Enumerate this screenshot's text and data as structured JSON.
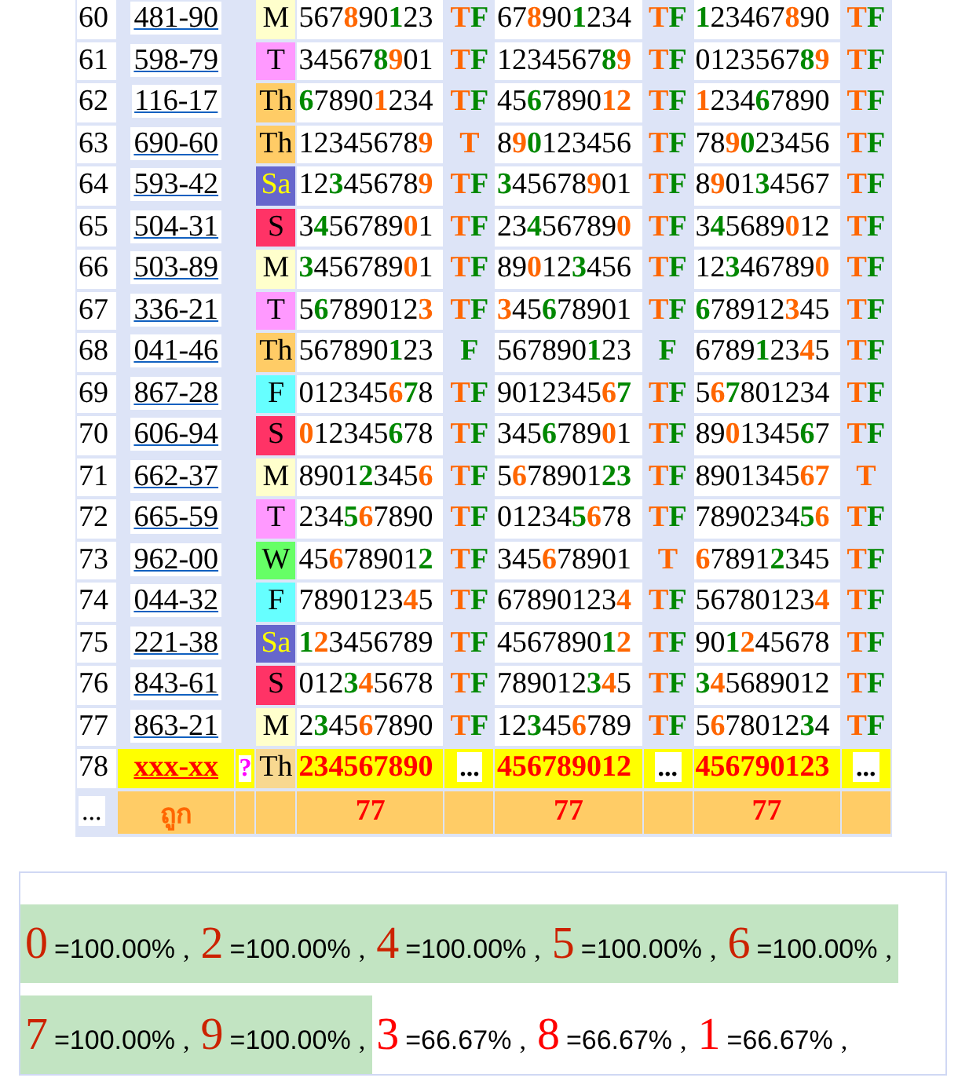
{
  "rows": [
    {
      "kind": "result",
      "no": "60",
      "code": "481-90",
      "day": {
        "text": "M",
        "color": "#ffffcc"
      },
      "draws": [
        {
          "parts": [
            {
              "text": "567"
            },
            {
              "text": "8",
              "color": "#ff6600"
            },
            {
              "text": "90"
            },
            {
              "text": "1",
              "color": "#008800"
            },
            {
              "text": "23"
            }
          ],
          "verdict": [
            {
              "text": "T",
              "color": "#ff6600"
            },
            {
              "text": "F",
              "color": "#008800"
            }
          ]
        },
        {
          "parts": [
            {
              "text": "67"
            },
            {
              "text": "8",
              "color": "#ff6600"
            },
            {
              "text": "90"
            },
            {
              "text": "1",
              "color": "#008800"
            },
            {
              "text": "234"
            }
          ],
          "verdict": [
            {
              "text": "T",
              "color": "#ff6600"
            },
            {
              "text": "F",
              "color": "#008800"
            }
          ]
        },
        {
          "parts": [
            {
              "text": "1",
              "color": "#008800"
            },
            {
              "text": "23467"
            },
            {
              "text": "8",
              "color": "#ff6600"
            },
            {
              "text": "90"
            }
          ],
          "verdict": [
            {
              "text": "T",
              "color": "#ff6600"
            },
            {
              "text": "F",
              "color": "#008800"
            }
          ]
        }
      ]
    },
    {
      "kind": "result",
      "no": "61",
      "code": "598-79",
      "day": {
        "text": "T",
        "color": "#ff99ff"
      },
      "draws": [
        {
          "parts": [
            {
              "text": "34567"
            },
            {
              "text": "8",
              "color": "#008800"
            },
            {
              "text": "9",
              "color": "#ff6600"
            },
            {
              "text": "01"
            }
          ],
          "verdict": [
            {
              "text": "T",
              "color": "#ff6600"
            },
            {
              "text": "F",
              "color": "#008800"
            }
          ]
        },
        {
          "parts": [
            {
              "text": "1234567"
            },
            {
              "text": "8",
              "color": "#008800"
            },
            {
              "text": "9",
              "color": "#ff6600"
            }
          ],
          "verdict": [
            {
              "text": "T",
              "color": "#ff6600"
            },
            {
              "text": "F",
              "color": "#008800"
            }
          ]
        },
        {
          "parts": [
            {
              "text": "0123567"
            },
            {
              "text": "8",
              "color": "#008800"
            },
            {
              "text": "9",
              "color": "#ff6600"
            }
          ],
          "verdict": [
            {
              "text": "T",
              "color": "#ff6600"
            },
            {
              "text": "F",
              "color": "#008800"
            }
          ]
        }
      ]
    },
    {
      "kind": "result",
      "no": "62",
      "code": "116-17",
      "day": {
        "text": "Th",
        "color": "#ffcc66"
      },
      "draws": [
        {
          "parts": [
            {
              "text": "6",
              "color": "#008800"
            },
            {
              "text": "7890"
            },
            {
              "text": "1",
              "color": "#ff6600"
            },
            {
              "text": "234"
            }
          ],
          "verdict": [
            {
              "text": "T",
              "color": "#ff6600"
            },
            {
              "text": "F",
              "color": "#008800"
            }
          ]
        },
        {
          "parts": [
            {
              "text": "45"
            },
            {
              "text": "6",
              "color": "#008800"
            },
            {
              "text": "7890"
            },
            {
              "text": "12",
              "color": "#ff6600"
            }
          ],
          "verdict": [
            {
              "text": "T",
              "color": "#ff6600"
            },
            {
              "text": "F",
              "color": "#008800"
            }
          ]
        },
        {
          "parts": [
            {
              "text": "1",
              "color": "#ff6600"
            },
            {
              "text": "234"
            },
            {
              "text": "6",
              "color": "#008800"
            },
            {
              "text": "7890"
            }
          ],
          "verdict": [
            {
              "text": "T",
              "color": "#ff6600"
            },
            {
              "text": "F",
              "color": "#008800"
            }
          ]
        }
      ]
    },
    {
      "kind": "result",
      "no": "63",
      "code": "690-60",
      "day": {
        "text": "Th",
        "color": "#ffcc66"
      },
      "draws": [
        {
          "parts": [
            {
              "text": "12345678"
            },
            {
              "text": "9",
              "color": "#ff6600"
            }
          ],
          "verdict": [
            {
              "text": "T",
              "color": "#ff6600"
            }
          ]
        },
        {
          "parts": [
            {
              "text": "8"
            },
            {
              "text": "9",
              "color": "#ff6600"
            },
            {
              "text": "0",
              "color": "#008800"
            },
            {
              "text": "123456"
            }
          ],
          "verdict": [
            {
              "text": "T",
              "color": "#ff6600"
            },
            {
              "text": "F",
              "color": "#008800"
            }
          ]
        },
        {
          "parts": [
            {
              "text": "78"
            },
            {
              "text": "9",
              "color": "#ff6600"
            },
            {
              "text": "0",
              "color": "#008800"
            },
            {
              "text": "23456"
            }
          ],
          "verdict": [
            {
              "text": "T",
              "color": "#ff6600"
            },
            {
              "text": "F",
              "color": "#008800"
            }
          ]
        }
      ]
    },
    {
      "kind": "result",
      "no": "64",
      "code": "593-42",
      "day": {
        "text": "Sa",
        "color": "#6666cc",
        "kind": "inverse"
      },
      "draws": [
        {
          "parts": [
            {
              "text": "12"
            },
            {
              "text": "3",
              "color": "#008800"
            },
            {
              "text": "45678"
            },
            {
              "text": "9",
              "color": "#ff6600"
            }
          ],
          "verdict": [
            {
              "text": "T",
              "color": "#ff6600"
            },
            {
              "text": "F",
              "color": "#008800"
            }
          ]
        },
        {
          "parts": [
            {
              "text": "3",
              "color": "#008800"
            },
            {
              "text": "45678"
            },
            {
              "text": "9",
              "color": "#ff6600"
            },
            {
              "text": "01"
            }
          ],
          "verdict": [
            {
              "text": "T",
              "color": "#ff6600"
            },
            {
              "text": "F",
              "color": "#008800"
            }
          ]
        },
        {
          "parts": [
            {
              "text": "8"
            },
            {
              "text": "9",
              "color": "#ff6600"
            },
            {
              "text": "01"
            },
            {
              "text": "3",
              "color": "#008800"
            },
            {
              "text": "4567"
            }
          ],
          "verdict": [
            {
              "text": "T",
              "color": "#ff6600"
            },
            {
              "text": "F",
              "color": "#008800"
            }
          ]
        }
      ]
    },
    {
      "kind": "result",
      "no": "65",
      "code": "504-31",
      "day": {
        "text": "S",
        "color": "#ff3366"
      },
      "draws": [
        {
          "parts": [
            {
              "text": "3"
            },
            {
              "text": "4",
              "color": "#008800"
            },
            {
              "text": "56789"
            },
            {
              "text": "0",
              "color": "#ff6600"
            },
            {
              "text": "1"
            }
          ],
          "verdict": [
            {
              "text": "T",
              "color": "#ff6600"
            },
            {
              "text": "F",
              "color": "#008800"
            }
          ]
        },
        {
          "parts": [
            {
              "text": "23"
            },
            {
              "text": "4",
              "color": "#008800"
            },
            {
              "text": "56789"
            },
            {
              "text": "0",
              "color": "#ff6600"
            }
          ],
          "verdict": [
            {
              "text": "T",
              "color": "#ff6600"
            },
            {
              "text": "F",
              "color": "#008800"
            }
          ]
        },
        {
          "parts": [
            {
              "text": "3"
            },
            {
              "text": "4",
              "color": "#008800"
            },
            {
              "text": "5689"
            },
            {
              "text": "0",
              "color": "#ff6600"
            },
            {
              "text": "12"
            }
          ],
          "verdict": [
            {
              "text": "T",
              "color": "#ff6600"
            },
            {
              "text": "F",
              "color": "#008800"
            }
          ]
        }
      ]
    },
    {
      "kind": "result",
      "no": "66",
      "code": "503-89",
      "day": {
        "text": "M",
        "color": "#ffffcc"
      },
      "draws": [
        {
          "parts": [
            {
              "text": "3",
              "color": "#008800"
            },
            {
              "text": "456789"
            },
            {
              "text": "0",
              "color": "#ff6600"
            },
            {
              "text": "1"
            }
          ],
          "verdict": [
            {
              "text": "T",
              "color": "#ff6600"
            },
            {
              "text": "F",
              "color": "#008800"
            }
          ]
        },
        {
          "parts": [
            {
              "text": "89"
            },
            {
              "text": "0",
              "color": "#ff6600"
            },
            {
              "text": "12"
            },
            {
              "text": "3",
              "color": "#008800"
            },
            {
              "text": "456"
            }
          ],
          "verdict": [
            {
              "text": "T",
              "color": "#ff6600"
            },
            {
              "text": "F",
              "color": "#008800"
            }
          ]
        },
        {
          "parts": [
            {
              "text": "12"
            },
            {
              "text": "3",
              "color": "#008800"
            },
            {
              "text": "46789"
            },
            {
              "text": "0",
              "color": "#ff6600"
            }
          ],
          "verdict": [
            {
              "text": "T",
              "color": "#ff6600"
            },
            {
              "text": "F",
              "color": "#008800"
            }
          ]
        }
      ]
    },
    {
      "kind": "result",
      "no": "67",
      "code": "336-21",
      "day": {
        "text": "T",
        "color": "#ff99ff"
      },
      "draws": [
        {
          "parts": [
            {
              "text": "5"
            },
            {
              "text": "6",
              "color": "#008800"
            },
            {
              "text": "78901"
            },
            {
              "text": "2"
            },
            {
              "text": "3",
              "color": "#ff6600"
            }
          ],
          "verdict": [
            {
              "text": "T",
              "color": "#ff6600"
            },
            {
              "text": "F",
              "color": "#008800"
            }
          ]
        },
        {
          "parts": [
            {
              "text": "3",
              "color": "#ff6600"
            },
            {
              "text": "45"
            },
            {
              "text": "6",
              "color": "#008800"
            },
            {
              "text": "78901"
            }
          ],
          "verdict": [
            {
              "text": "T",
              "color": "#ff6600"
            },
            {
              "text": "F",
              "color": "#008800"
            }
          ]
        },
        {
          "parts": [
            {
              "text": "6",
              "color": "#008800"
            },
            {
              "text": "7891"
            },
            {
              "text": "2"
            },
            {
              "text": "3",
              "color": "#ff6600"
            },
            {
              "text": "45"
            }
          ],
          "verdict": [
            {
              "text": "T",
              "color": "#ff6600"
            },
            {
              "text": "F",
              "color": "#008800"
            }
          ]
        }
      ]
    },
    {
      "kind": "result",
      "no": "68",
      "code": "041-46",
      "day": {
        "text": "Th",
        "color": "#ffcc66"
      },
      "draws": [
        {
          "parts": [
            {
              "text": "567890"
            },
            {
              "text": "1",
              "color": "#008800"
            },
            {
              "text": "23"
            }
          ],
          "verdict": [
            {
              "text": "F",
              "color": "#008800"
            }
          ]
        },
        {
          "parts": [
            {
              "text": "567890"
            },
            {
              "text": "1",
              "color": "#008800"
            },
            {
              "text": "23"
            }
          ],
          "verdict": [
            {
              "text": "F",
              "color": "#008800"
            }
          ]
        },
        {
          "parts": [
            {
              "text": "6789"
            },
            {
              "text": "1",
              "color": "#008800"
            },
            {
              "text": "23"
            },
            {
              "text": "4",
              "color": "#ff6600"
            },
            {
              "text": "5"
            }
          ],
          "verdict": [
            {
              "text": "T",
              "color": "#ff6600"
            },
            {
              "text": "F",
              "color": "#008800"
            }
          ]
        }
      ]
    },
    {
      "kind": "result",
      "no": "69",
      "code": "867-28",
      "day": {
        "text": "F",
        "color": "#66ffff"
      },
      "draws": [
        {
          "parts": [
            {
              "text": "012345"
            },
            {
              "text": "6",
              "color": "#ff6600"
            },
            {
              "text": "7",
              "color": "#008800"
            },
            {
              "text": "8"
            }
          ],
          "verdict": [
            {
              "text": "T",
              "color": "#ff6600"
            },
            {
              "text": "F",
              "color": "#008800"
            }
          ]
        },
        {
          "parts": [
            {
              "text": "9012345"
            },
            {
              "text": "6",
              "color": "#ff6600"
            },
            {
              "text": "7",
              "color": "#008800"
            }
          ],
          "verdict": [
            {
              "text": "T",
              "color": "#ff6600"
            },
            {
              "text": "F",
              "color": "#008800"
            }
          ]
        },
        {
          "parts": [
            {
              "text": "5"
            },
            {
              "text": "6",
              "color": "#ff6600"
            },
            {
              "text": "7",
              "color": "#008800"
            },
            {
              "text": "801234"
            }
          ],
          "verdict": [
            {
              "text": "T",
              "color": "#ff6600"
            },
            {
              "text": "F",
              "color": "#008800"
            }
          ]
        }
      ]
    },
    {
      "kind": "result",
      "no": "70",
      "code": "606-94",
      "day": {
        "text": "S",
        "color": "#ff3366"
      },
      "draws": [
        {
          "parts": [
            {
              "text": "0",
              "color": "#ff6600"
            },
            {
              "text": "12345"
            },
            {
              "text": "6",
              "color": "#008800"
            },
            {
              "text": "78"
            }
          ],
          "verdict": [
            {
              "text": "T",
              "color": "#ff6600"
            },
            {
              "text": "F",
              "color": "#008800"
            }
          ]
        },
        {
          "parts": [
            {
              "text": "345"
            },
            {
              "text": "6",
              "color": "#008800"
            },
            {
              "text": "789"
            },
            {
              "text": "0",
              "color": "#ff6600"
            },
            {
              "text": "1"
            }
          ],
          "verdict": [
            {
              "text": "T",
              "color": "#ff6600"
            },
            {
              "text": "F",
              "color": "#008800"
            }
          ]
        },
        {
          "parts": [
            {
              "text": "89"
            },
            {
              "text": "0",
              "color": "#ff6600"
            },
            {
              "text": "1345"
            },
            {
              "text": "6",
              "color": "#008800"
            },
            {
              "text": "7"
            }
          ],
          "verdict": [
            {
              "text": "T",
              "color": "#ff6600"
            },
            {
              "text": "F",
              "color": "#008800"
            }
          ]
        }
      ]
    },
    {
      "kind": "result",
      "no": "71",
      "code": "662-37",
      "day": {
        "text": "M",
        "color": "#ffffcc"
      },
      "draws": [
        {
          "parts": [
            {
              "text": "8901"
            },
            {
              "text": "2",
              "color": "#008800"
            },
            {
              "text": "345"
            },
            {
              "text": "6",
              "color": "#ff6600"
            }
          ],
          "verdict": [
            {
              "text": "T",
              "color": "#ff6600"
            },
            {
              "text": "F",
              "color": "#008800"
            }
          ]
        },
        {
          "parts": [
            {
              "text": "5"
            },
            {
              "text": "6",
              "color": "#ff6600"
            },
            {
              "text": "78901"
            },
            {
              "text": "23",
              "color": "#008800"
            }
          ],
          "verdict": [
            {
              "text": "T",
              "color": "#ff6600"
            },
            {
              "text": "F",
              "color": "#008800"
            }
          ]
        },
        {
          "parts": [
            {
              "text": "890134"
            },
            {
              "text": "5"
            },
            {
              "text": "67",
              "color": "#ff6600"
            }
          ],
          "verdict": [
            {
              "text": "T",
              "color": "#ff6600"
            }
          ]
        }
      ]
    },
    {
      "kind": "result",
      "no": "72",
      "code": "665-59",
      "day": {
        "text": "T",
        "color": "#ff99ff"
      },
      "draws": [
        {
          "parts": [
            {
              "text": "234"
            },
            {
              "text": "5",
              "color": "#008800"
            },
            {
              "text": "6",
              "color": "#ff6600"
            },
            {
              "text": "7890"
            }
          ],
          "verdict": [
            {
              "text": "T",
              "color": "#ff6600"
            },
            {
              "text": "F",
              "color": "#008800"
            }
          ]
        },
        {
          "parts": [
            {
              "text": "01234"
            },
            {
              "text": "5",
              "color": "#008800"
            },
            {
              "text": "6",
              "color": "#ff6600"
            },
            {
              "text": "78"
            }
          ],
          "verdict": [
            {
              "text": "T",
              "color": "#ff6600"
            },
            {
              "text": "F",
              "color": "#008800"
            }
          ]
        },
        {
          "parts": [
            {
              "text": "7890234"
            },
            {
              "text": "5",
              "color": "#008800"
            },
            {
              "text": "6",
              "color": "#ff6600"
            }
          ],
          "verdict": [
            {
              "text": "T",
              "color": "#ff6600"
            },
            {
              "text": "F",
              "color": "#008800"
            }
          ]
        }
      ]
    },
    {
      "kind": "result",
      "no": "73",
      "code": "962-00",
      "day": {
        "text": "W",
        "color": "#66ff66"
      },
      "draws": [
        {
          "parts": [
            {
              "text": "45"
            },
            {
              "text": "6",
              "color": "#ff6600"
            },
            {
              "text": "78901"
            },
            {
              "text": "2",
              "color": "#008800"
            }
          ],
          "verdict": [
            {
              "text": "T",
              "color": "#ff6600"
            },
            {
              "text": "F",
              "color": "#008800"
            }
          ]
        },
        {
          "parts": [
            {
              "text": "345"
            },
            {
              "text": "6",
              "color": "#ff6600"
            },
            {
              "text": "78901"
            }
          ],
          "verdict": [
            {
              "text": "T",
              "color": "#ff6600"
            }
          ]
        },
        {
          "parts": [
            {
              "text": "6",
              "color": "#ff6600"
            },
            {
              "text": "7891"
            },
            {
              "text": "2",
              "color": "#008800"
            },
            {
              "text": "345"
            }
          ],
          "verdict": [
            {
              "text": "T",
              "color": "#ff6600"
            },
            {
              "text": "F",
              "color": "#008800"
            }
          ]
        }
      ]
    },
    {
      "kind": "result",
      "no": "74",
      "code": "044-32",
      "day": {
        "text": "F",
        "color": "#66ffff"
      },
      "draws": [
        {
          "parts": [
            {
              "text": "7890123"
            },
            {
              "text": "4",
              "color": "#ff6600"
            },
            {
              "text": "5"
            }
          ],
          "verdict": [
            {
              "text": "T",
              "color": "#ff6600"
            },
            {
              "text": "F",
              "color": "#008800"
            }
          ]
        },
        {
          "parts": [
            {
              "text": "67890123"
            },
            {
              "text": "4",
              "color": "#ff6600"
            }
          ],
          "verdict": [
            {
              "text": "T",
              "color": "#ff6600"
            },
            {
              "text": "F",
              "color": "#008800"
            }
          ]
        },
        {
          "parts": [
            {
              "text": "56780123"
            },
            {
              "text": "4",
              "color": "#ff6600"
            }
          ],
          "verdict": [
            {
              "text": "T",
              "color": "#ff6600"
            },
            {
              "text": "F",
              "color": "#008800"
            }
          ]
        }
      ]
    },
    {
      "kind": "result",
      "no": "75",
      "code": "221-38",
      "day": {
        "text": "Sa",
        "color": "#6666cc",
        "kind": "inverse"
      },
      "draws": [
        {
          "parts": [
            {
              "text": "1",
              "color": "#008800"
            },
            {
              "text": "2",
              "color": "#ff6600"
            },
            {
              "text": "3456789"
            }
          ],
          "verdict": [
            {
              "text": "T",
              "color": "#ff6600"
            },
            {
              "text": "F",
              "color": "#008800"
            }
          ]
        },
        {
          "parts": [
            {
              "text": "4567890"
            },
            {
              "text": "1",
              "color": "#008800"
            },
            {
              "text": "2",
              "color": "#ff6600"
            }
          ],
          "verdict": [
            {
              "text": "T",
              "color": "#ff6600"
            },
            {
              "text": "F",
              "color": "#008800"
            }
          ]
        },
        {
          "parts": [
            {
              "text": "90"
            },
            {
              "text": "1",
              "color": "#008800"
            },
            {
              "text": "2",
              "color": "#ff6600"
            },
            {
              "text": "45678"
            }
          ],
          "verdict": [
            {
              "text": "T",
              "color": "#ff6600"
            },
            {
              "text": "F",
              "color": "#008800"
            }
          ]
        }
      ]
    },
    {
      "kind": "result",
      "no": "76",
      "code": "843-61",
      "day": {
        "text": "S",
        "color": "#ff3366"
      },
      "draws": [
        {
          "parts": [
            {
              "text": "012"
            },
            {
              "text": "3",
              "color": "#008800"
            },
            {
              "text": "4",
              "color": "#ff6600"
            },
            {
              "text": "5678"
            }
          ],
          "verdict": [
            {
              "text": "T",
              "color": "#ff6600"
            },
            {
              "text": "F",
              "color": "#008800"
            }
          ]
        },
        {
          "parts": [
            {
              "text": "789012"
            },
            {
              "text": "3",
              "color": "#008800"
            },
            {
              "text": "4",
              "color": "#ff6600"
            },
            {
              "text": "5"
            }
          ],
          "verdict": [
            {
              "text": "T",
              "color": "#ff6600"
            },
            {
              "text": "F",
              "color": "#008800"
            }
          ]
        },
        {
          "parts": [
            {
              "text": "3",
              "color": "#008800"
            },
            {
              "text": "4",
              "color": "#ff6600"
            },
            {
              "text": "5689012"
            }
          ],
          "verdict": [
            {
              "text": "T",
              "color": "#ff6600"
            },
            {
              "text": "F",
              "color": "#008800"
            }
          ]
        }
      ]
    },
    {
      "kind": "result",
      "no": "77",
      "code": "863-21",
      "day": {
        "text": "M",
        "color": "#ffffcc"
      },
      "draws": [
        {
          "parts": [
            {
              "text": "2"
            },
            {
              "text": "3",
              "color": "#008800"
            },
            {
              "text": "45"
            },
            {
              "text": "6",
              "color": "#ff6600"
            },
            {
              "text": "7890"
            }
          ],
          "verdict": [
            {
              "text": "T",
              "color": "#ff6600"
            },
            {
              "text": "F",
              "color": "#008800"
            }
          ]
        },
        {
          "parts": [
            {
              "text": "12"
            },
            {
              "text": "3",
              "color": "#008800"
            },
            {
              "text": "45"
            },
            {
              "text": "6",
              "color": "#ff6600"
            },
            {
              "text": "789"
            }
          ],
          "verdict": [
            {
              "text": "T",
              "color": "#ff6600"
            },
            {
              "text": "F",
              "color": "#008800"
            }
          ]
        },
        {
          "parts": [
            {
              "text": "5"
            },
            {
              "text": "6",
              "color": "#ff6600"
            },
            {
              "text": "78012"
            },
            {
              "text": "3",
              "color": "#008800"
            },
            {
              "text": "4"
            }
          ],
          "verdict": [
            {
              "text": "T",
              "color": "#ff6600"
            },
            {
              "text": "F",
              "color": "#008800"
            }
          ]
        }
      ]
    },
    {
      "kind": "pending",
      "no": "78",
      "code": "xxx-xx",
      "flag": "?",
      "day": {
        "text": "Th",
        "color": "#f8d890"
      },
      "draws": [
        {
          "number": "234567890",
          "verdict": "..."
        },
        {
          "number": "456789012",
          "verdict": "..."
        },
        {
          "number": "456790123",
          "verdict": "..."
        }
      ]
    }
  ],
  "footer": {
    "label": "...",
    "title": "ถูก",
    "totals": [
      "77",
      "77",
      "77"
    ]
  },
  "stats": [
    {
      "digit": "0",
      "value": "=100.00%",
      "sep": ",",
      "highlighted": true,
      "color": "#cc2200"
    },
    {
      "digit": "2",
      "value": "=100.00%",
      "sep": ",",
      "highlighted": true,
      "color": "#cc2200"
    },
    {
      "digit": "4",
      "value": "=100.00%",
      "sep": ",",
      "highlighted": true,
      "color": "#cc2200"
    },
    {
      "digit": "5",
      "value": "=100.00%",
      "sep": ",",
      "highlighted": true,
      "color": "#cc2200"
    },
    {
      "digit": "6",
      "value": "=100.00%",
      "sep": ",",
      "highlighted": true,
      "color": "#cc2200"
    },
    {
      "digit": "7",
      "value": "=100.00%",
      "sep": ",",
      "highlighted": true,
      "color": "#cc2200"
    },
    {
      "digit": "9",
      "value": "=100.00%",
      "sep": ",",
      "highlighted": true,
      "color": "#cc2200"
    },
    {
      "digit": "3",
      "value": "=66.67%",
      "sep": ",",
      "highlighted": false,
      "color": "#ff0000"
    },
    {
      "digit": "8",
      "value": "=66.67%",
      "sep": ",",
      "highlighted": false,
      "color": "#ff0000"
    },
    {
      "digit": "1",
      "value": "=66.67%",
      "sep": ",",
      "highlighted": false,
      "color": "#ff0000"
    }
  ]
}
